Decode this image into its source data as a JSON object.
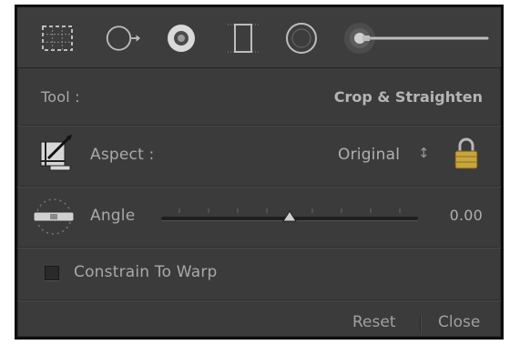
{
  "tools": [
    {
      "name": "crop-overlay"
    },
    {
      "name": "spot-removal"
    },
    {
      "name": "red-eye"
    },
    {
      "name": "graduated-filter"
    },
    {
      "name": "radial-filter"
    },
    {
      "name": "adjustment-brush"
    }
  ],
  "tool_row": {
    "label": "Tool :",
    "value": "Crop & Straighten"
  },
  "aspect_row": {
    "label": "Aspect :",
    "value": "Original",
    "arrows": "↕"
  },
  "angle_row": {
    "label": "Angle",
    "value": "0.00",
    "slider_fraction": 0.5
  },
  "constrain": {
    "label": "Constrain To Warp",
    "checked": false
  },
  "footer": {
    "reset": "Reset",
    "close": "Close"
  }
}
